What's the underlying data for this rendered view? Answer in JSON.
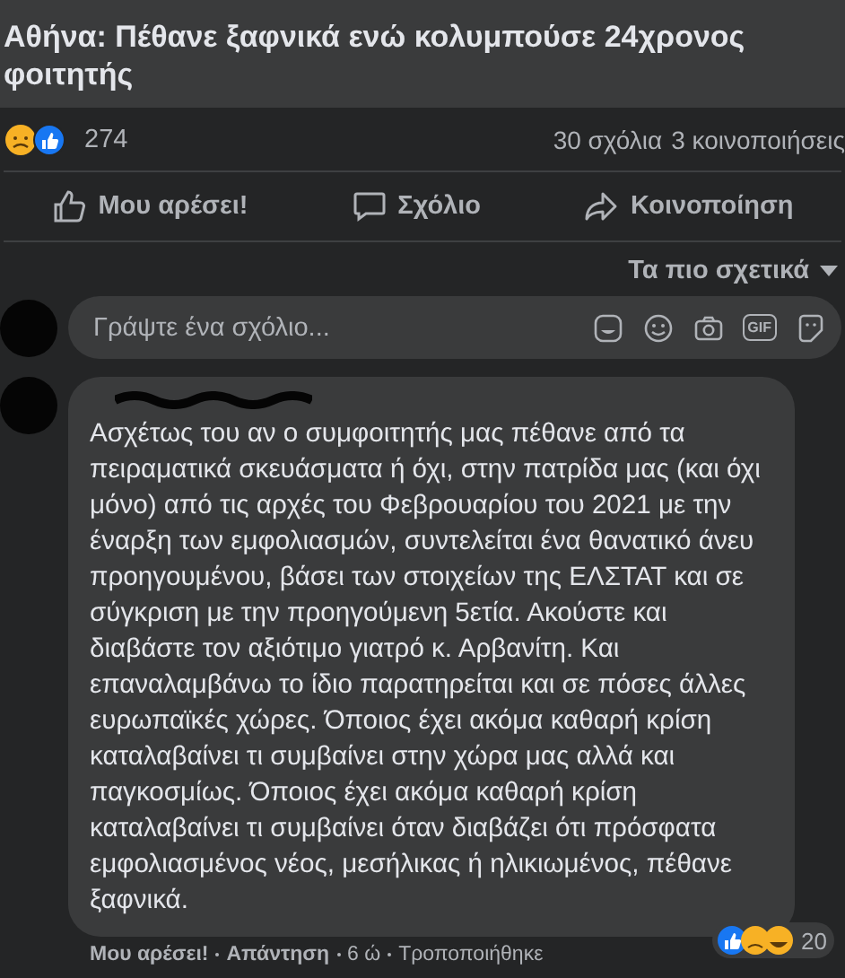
{
  "post": {
    "title": "Αθήνα: Πέθανε ξαφνικά ενώ κολυμπούσε 24χρονος φοιτητής",
    "reaction_count": "274",
    "comments": "30 σχόλια",
    "shares": "3 κοινοποιήσεις"
  },
  "actions": [
    {
      "label": "Μου αρέσει!",
      "kind": "like"
    },
    {
      "label": "Σχόλιο",
      "kind": "comment"
    },
    {
      "label": "Κοινοποίηση",
      "kind": "share"
    }
  ],
  "sort": {
    "label": "Τα πιο σχετικά"
  },
  "composer": {
    "placeholder": "Γράψτε ένα σχόλιο...",
    "gif_label": "GIF"
  },
  "comment": {
    "text": "Ασχέτως του αν ο συμφοιτητής μας πέθανε από τα πειραματικά σκευάσματα ή όχι, στην πατρίδα μας (και όχι μόνο) από τις αρχές του Φεβρουαρίου του 2021 με την έναρξη των εμφολιασμών, συντελείται ένα θανατικό άνευ προηγουμένου, βάσει των στοιχείων της ΕΛΣΤΑΤ και σε σύγκριση με την προηγούμενη 5ετία. Ακούστε και διαβάστε τον αξιότιμο γιατρό κ. Αρβανίτη. Και επαναλαμβάνω το ίδιο παρατηρείται και σε πόσες άλλες ευρωπαϊκές χώρες. Όποιος έχει ακόμα καθαρή κρίση καταλαβαίνει τι συμβαίνει στην χώρα μας αλλά και παγκοσμίως. Όποιος έχει ακόμα καθαρή κρίση καταλαβαίνει τι συμβαίνει όταν διαβάζει ότι πρόσφατα εμφολιασμένος νέος, μεσήλικας ή ηλικιωμένος, πέθανε ξαφνικά.",
    "reaction_count": "20",
    "footer": [
      "Μου αρέσει!",
      "Απάντηση",
      "6 ώ",
      "Τροποποιήθηκε"
    ]
  }
}
